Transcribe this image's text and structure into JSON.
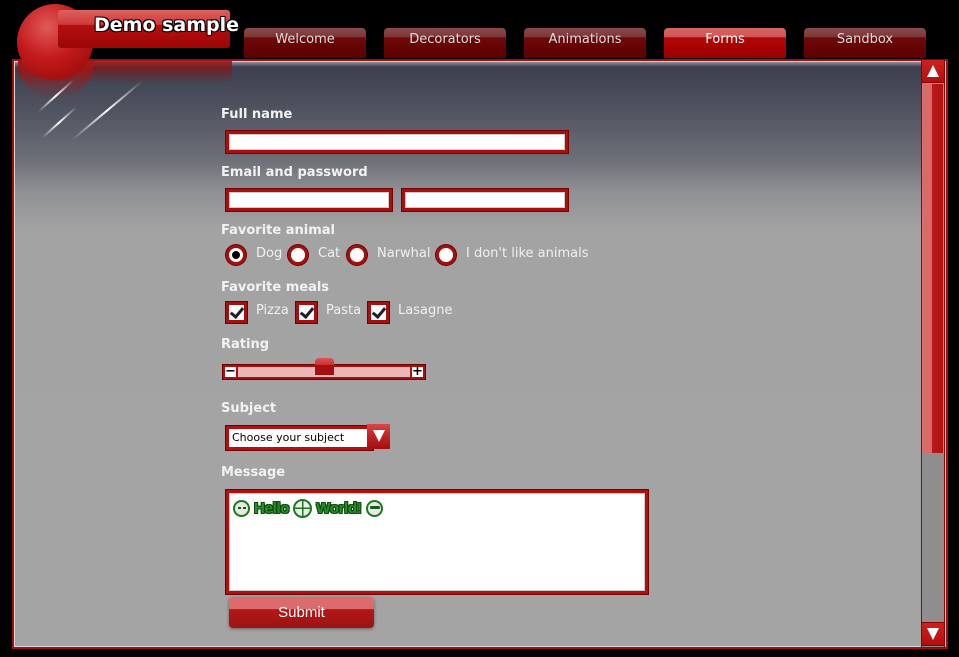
{
  "app": {
    "title": "Demo sample"
  },
  "tabs": [
    {
      "label": "Welcome",
      "active": false
    },
    {
      "label": "Decorators",
      "active": false
    },
    {
      "label": "Animations",
      "active": false
    },
    {
      "label": "Forms",
      "active": true
    },
    {
      "label": "Sandbox",
      "active": false
    }
  ],
  "form": {
    "full_name": {
      "label": "Full name",
      "value": ""
    },
    "email_password": {
      "label": "Email and password",
      "email_value": "",
      "password_value": ""
    },
    "favorite_animal": {
      "label": "Favorite animal",
      "options": [
        "Dog",
        "Cat",
        "Narwhal",
        "I don't like animals"
      ],
      "selected": "Dog"
    },
    "favorite_meals": {
      "label": "Favorite meals",
      "options": [
        {
          "label": "Pizza",
          "checked": true
        },
        {
          "label": "Pasta",
          "checked": true
        },
        {
          "label": "Lasagne",
          "checked": true
        }
      ]
    },
    "rating": {
      "label": "Rating",
      "value_fraction": 0.5,
      "minus_icon": "minus-icon",
      "plus_icon": "plus-icon"
    },
    "subject": {
      "label": "Subject",
      "selected": "Choose your subject",
      "dropdown_icon": "chevron-down-icon"
    },
    "message": {
      "label": "Message",
      "content": [
        {
          "type": "icon",
          "name": "smiley-icon"
        },
        {
          "type": "text",
          "value": "Hello"
        },
        {
          "type": "icon",
          "name": "globe-icon"
        },
        {
          "type": "text",
          "value": "World!"
        },
        {
          "type": "icon",
          "name": "cool-smiley-icon"
        }
      ],
      "text_color": "#2c8c2c"
    },
    "submit_label": "Submit"
  },
  "scrollbar": {
    "position_fraction": 0.0,
    "visible_fraction": 0.66
  },
  "colors": {
    "accent": "#b01010",
    "accent_dark": "#700000",
    "tab_active": "#b30606",
    "tab_inactive": "#6e0808",
    "panel_bg": "#a4a4a4"
  }
}
